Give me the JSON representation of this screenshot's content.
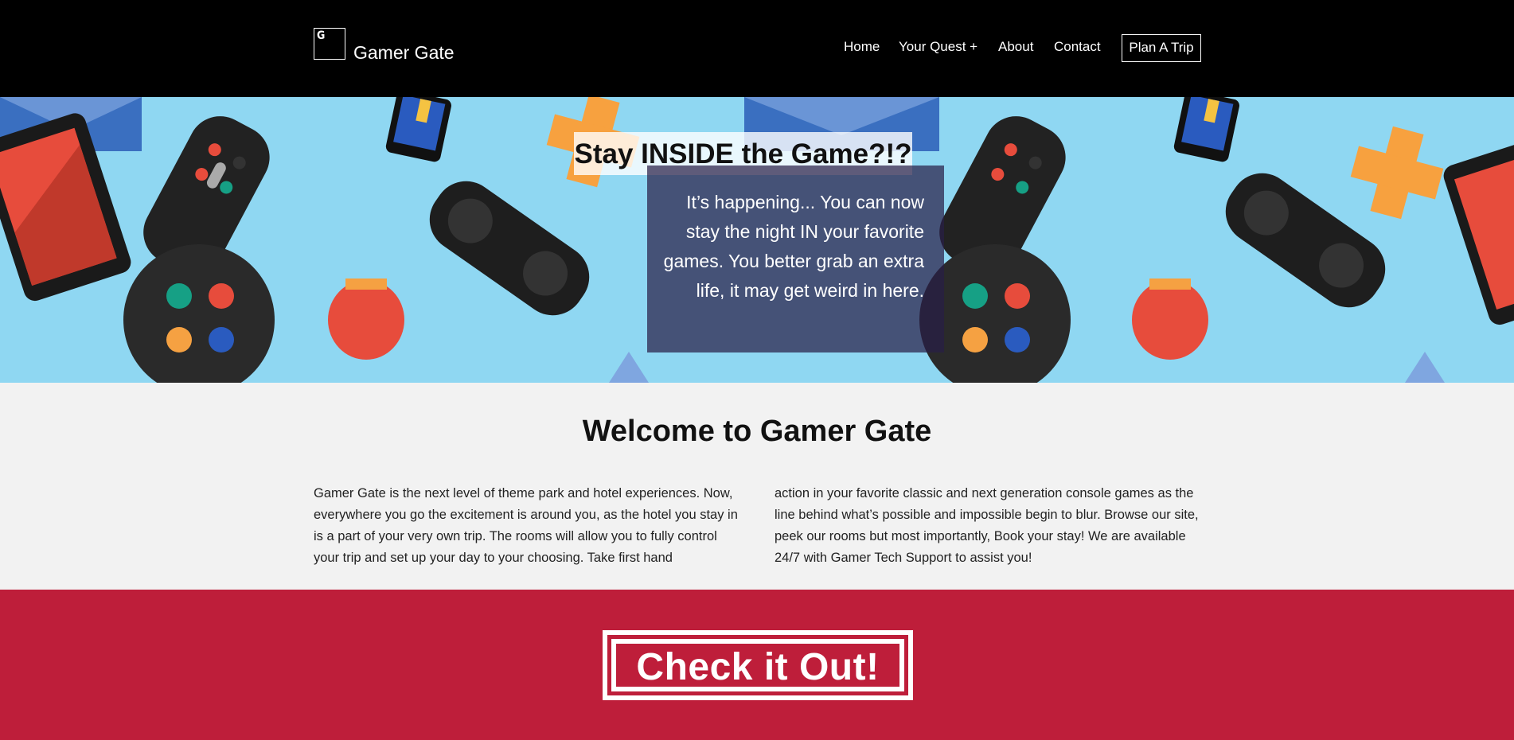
{
  "header": {
    "logo_letter": "G",
    "site_title": "Gamer Gate",
    "nav": [
      {
        "label": "Home"
      },
      {
        "label": "Your Quest  +"
      },
      {
        "label": "About"
      },
      {
        "label": "Contact"
      }
    ],
    "cta_label": "Plan A Trip"
  },
  "hero": {
    "title": "Stay INSIDE the Game?!?",
    "text": "It’s happening... You can now stay the night IN your favorite games. You better grab an extra life, it may get weird in here.",
    "colors": {
      "background": "#8fd7f2",
      "overlay": "#2a1e46"
    }
  },
  "welcome": {
    "title": "Welcome to Gamer Gate",
    "col1": "Gamer Gate is the next level of theme park and hotel experiences. Now, everywhere you go the excitement is around you, as the hotel you stay in is a part of your very own trip. The rooms will allow you to fully control your trip and set up your day to your choosing. Take first hand",
    "col2": "action in your favorite classic and next generation console games as the line behind what’s possible and impossible begin to blur. Browse our site, peek our rooms but most importantly, Book your stay! We are available 24/7 with Gamer Tech Support to assist you!"
  },
  "cta": {
    "label": "Check it Out!",
    "color": "#be1e3a"
  }
}
